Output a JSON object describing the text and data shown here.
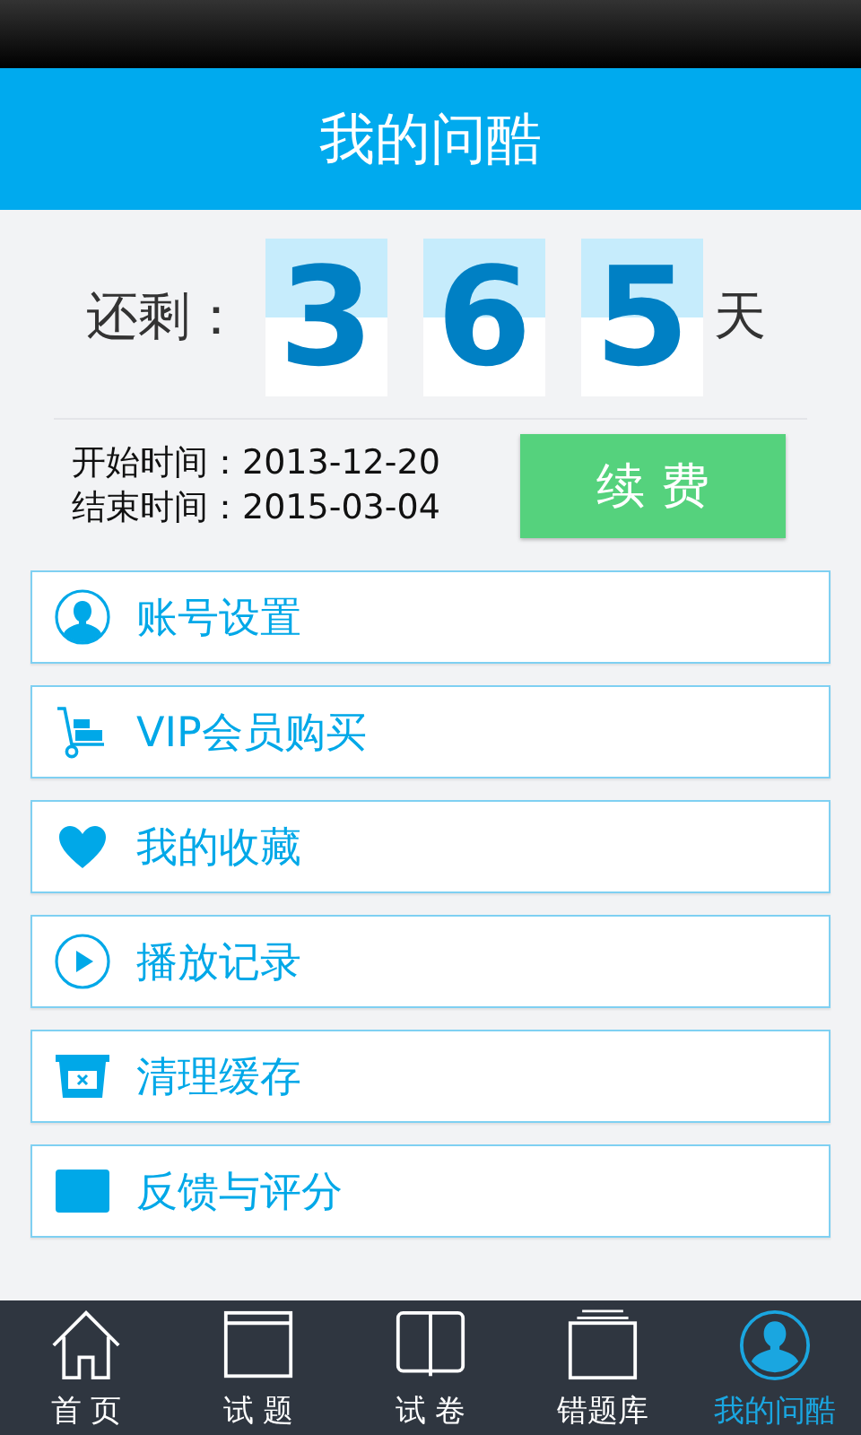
{
  "header": {
    "title": "我的问酷"
  },
  "countdown": {
    "label": "还剩：",
    "digits": [
      "3",
      "6",
      "5"
    ],
    "unit": "天"
  },
  "dates": [
    "开始时间：2013-12-20",
    "结束时间：2015-03-04"
  ],
  "renew_button": "续 费",
  "menu": [
    {
      "label": "账号设置"
    },
    {
      "label": "VIP会员购买"
    },
    {
      "label": "我的收藏"
    },
    {
      "label": "播放记录"
    },
    {
      "label": "清理缓存"
    },
    {
      "label": "反馈与评分"
    }
  ],
  "nav": [
    {
      "label": "首 页",
      "selected": false
    },
    {
      "label": "试 题",
      "selected": false
    },
    {
      "label": "试 卷",
      "selected": false
    },
    {
      "label": "错题库",
      "selected": false
    },
    {
      "label": "我的问酷",
      "selected": true
    }
  ]
}
